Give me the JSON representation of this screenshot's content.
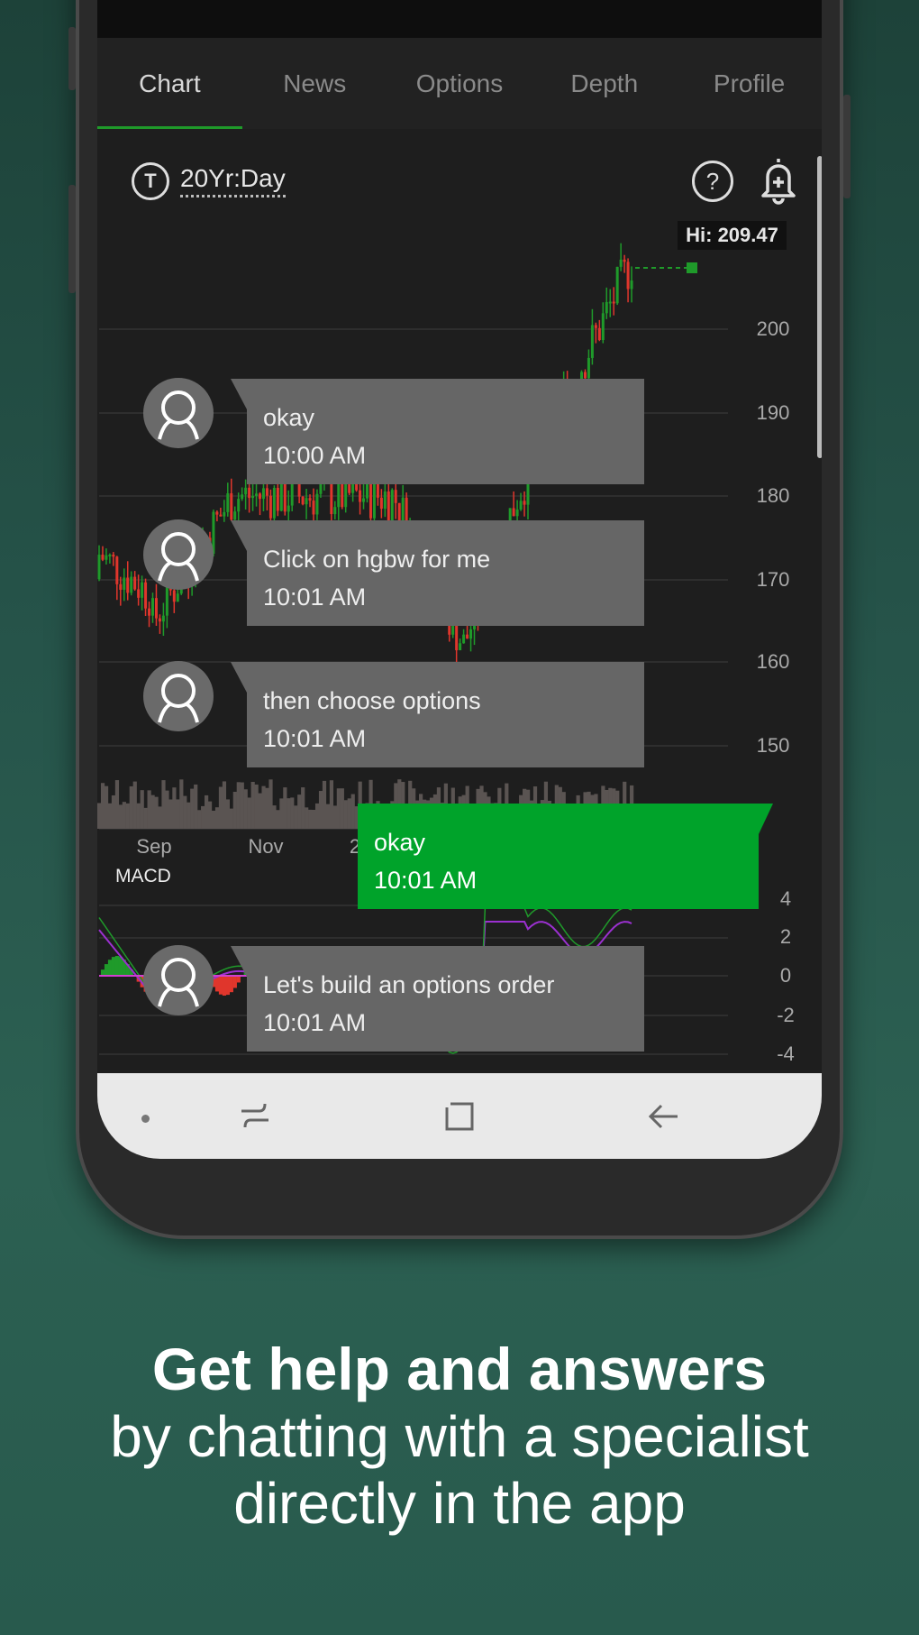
{
  "tabs": [
    {
      "label": "Chart",
      "active": true
    },
    {
      "label": "News"
    },
    {
      "label": "Options"
    },
    {
      "label": "Depth"
    },
    {
      "label": "Profile"
    }
  ],
  "chart": {
    "period": "20Yr:Day",
    "hi_label": "Hi: 209.47",
    "price_axis": [
      "200",
      "190",
      "180",
      "170",
      "160",
      "150"
    ],
    "x_axis": [
      "Sep",
      "Nov",
      "2"
    ],
    "indicator": "MACD",
    "macd_axis": [
      "4",
      "2",
      "0",
      "-2",
      "-4"
    ],
    "colors": {
      "up": "#1f9a2a",
      "down": "#e0362c",
      "signal": "#9b30d0",
      "volume": "#5a5452"
    }
  },
  "messages": [
    {
      "text": "okay",
      "time": "10:00 AM",
      "from": "specialist"
    },
    {
      "text": "Click on hgbw for me",
      "time": "10:01 AM",
      "from": "specialist"
    },
    {
      "text": "then choose options",
      "time": "10:01 AM",
      "from": "specialist"
    },
    {
      "text": "okay",
      "time": "10:01 AM",
      "from": "user"
    },
    {
      "text": "Let's build an options order",
      "time": "10:01 AM",
      "from": "specialist"
    }
  ],
  "caption": {
    "headline": "Get help and answers",
    "line1": "by chatting with a specialist",
    "line2": "directly in the app"
  },
  "accent": "#00a32a"
}
